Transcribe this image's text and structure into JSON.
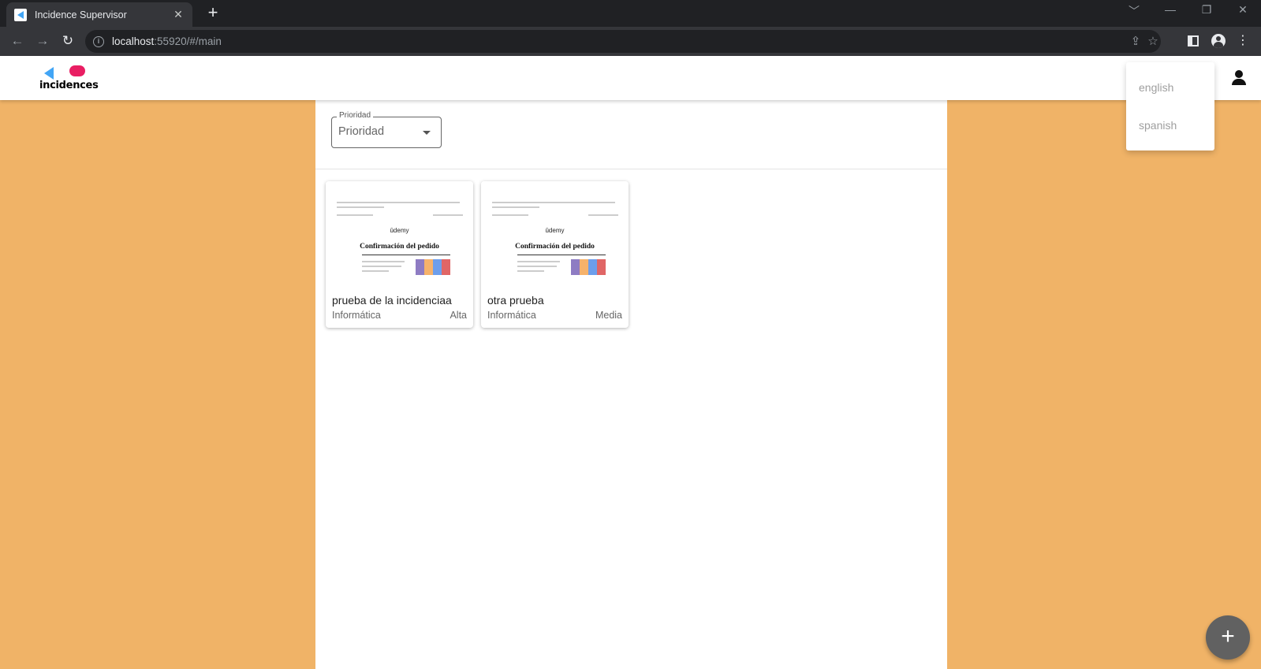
{
  "browser": {
    "tab_title": "Incidence Supervisor",
    "tab_close": "✕",
    "new_tab": "+",
    "url_host": "localhost",
    "url_rest": ":55920/#/main",
    "window_controls": [
      "﹀",
      "—",
      "❐",
      "✕"
    ]
  },
  "app": {
    "logo_text": "incidences",
    "language_menu": [
      "english",
      "spanish"
    ],
    "filter": {
      "label": "Prioridad",
      "value": "Prioridad"
    },
    "cards": [
      {
        "title": "prueba de la incidenciaa",
        "category": "Informática",
        "priority": "Alta",
        "thumb_brand": "ūdemy",
        "thumb_heading": "Confirmación del pedido"
      },
      {
        "title": "otra prueba",
        "category": "Informática",
        "priority": "Media",
        "thumb_brand": "ūdemy",
        "thumb_heading": "Confirmación del pedido"
      }
    ],
    "fab_label": "+"
  },
  "colors": {
    "background": "#f0b367",
    "fab": "#616161",
    "surface": "#ffffff"
  }
}
